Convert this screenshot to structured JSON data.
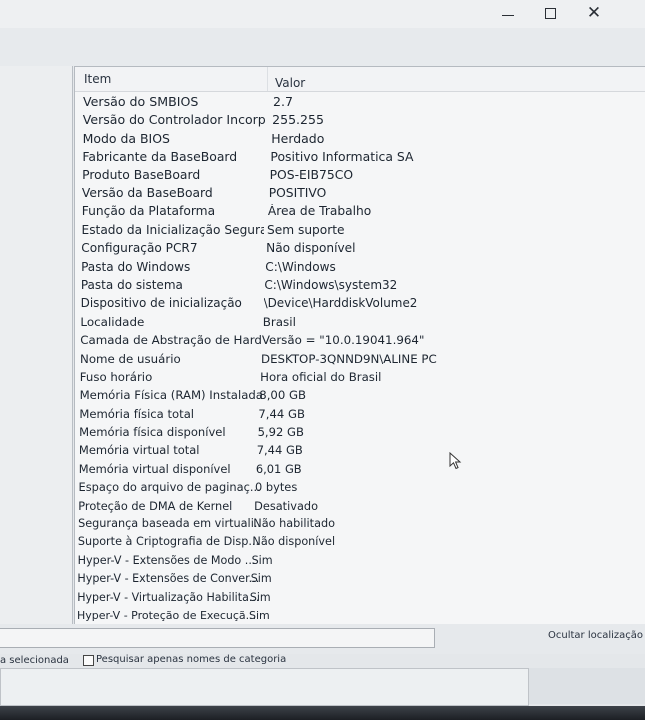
{
  "window": {
    "minimize_symbol": "",
    "maximize_symbol": "",
    "close_symbol": "✕"
  },
  "table": {
    "col_item": "Item",
    "col_valor": "Valor",
    "rows": [
      {
        "k": "Versão do SMBIOS",
        "v": "2.7"
      },
      {
        "k": "Versão do Controlador Incorp...",
        "v": "255.255"
      },
      {
        "k": "Modo da BIOS",
        "v": "Herdado"
      },
      {
        "k": "Fabricante da BaseBoard",
        "v": "Positivo Informatica SA"
      },
      {
        "k": "Produto BaseBoard",
        "v": "POS-EIB75CO"
      },
      {
        "k": "Versão da BaseBoard",
        "v": "POSITIVO"
      },
      {
        "k": "Função da Plataforma",
        "v": "Área de Trabalho"
      },
      {
        "k": "Estado da Inicialização Segura",
        "v": "Sem suporte"
      },
      {
        "k": "Configuração PCR7",
        "v": "Não disponível"
      },
      {
        "k": "Pasta do Windows",
        "v": "C:\\Windows"
      },
      {
        "k": "Pasta do sistema",
        "v": "C:\\Windows\\system32"
      },
      {
        "k": "Dispositivo de inicialização",
        "v": "\\Device\\HarddiskVolume2"
      },
      {
        "k": "Localidade",
        "v": "Brasil"
      },
      {
        "k": "Camada de Abstração de Hard...",
        "v": "Versão = \"10.0.19041.964\""
      },
      {
        "k": "Nome de usuário",
        "v": "DESKTOP-3QNND9N\\ALINE PC"
      },
      {
        "k": "Fuso horário",
        "v": "Hora oficial do Brasil"
      },
      {
        "k": "Memória Física (RAM) Instalada",
        "v": "8,00 GB"
      },
      {
        "k": "Memória física total",
        "v": "7,44 GB"
      },
      {
        "k": "Memória física disponível",
        "v": "5,92 GB"
      },
      {
        "k": "Memória virtual total",
        "v": "7,44 GB"
      },
      {
        "k": "Memória virtual disponível",
        "v": "6,01 GB"
      },
      {
        "k": "Espaço do arquivo de paginaç...",
        "v": "0 bytes"
      },
      {
        "k": "Proteção de DMA de Kernel",
        "v": "Desativado"
      },
      {
        "k": "Segurança baseada em virtuali...",
        "v": "Não habilitado"
      },
      {
        "k": "Suporte à Criptografia de Disp...",
        "v": "Não disponível"
      },
      {
        "k": "Hyper-V - Extensões de Modo ...",
        "v": "Sim"
      },
      {
        "k": "Hyper-V - Extensões de Conver...",
        "v": "Sim"
      },
      {
        "k": "Hyper-V - Virtualização Habilita...",
        "v": "Sim"
      },
      {
        "k": "Hyper-V - Proteção de Execuçã...",
        "v": "Sim"
      }
    ]
  },
  "search": {
    "value": "",
    "hide_location": "Ocultar localização"
  },
  "options": {
    "selected_label": "a selecionada",
    "category_checkbox_label": "Pesquisar apenas nomes de categoria"
  }
}
